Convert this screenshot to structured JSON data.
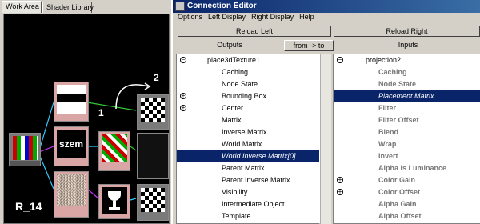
{
  "hypershade": {
    "tabs": [
      "Work Area",
      "Shader Library"
    ],
    "node_labels": {
      "r14": "R_14",
      "szem": "szem",
      "step1": "1",
      "step2": "2"
    }
  },
  "editor": {
    "title": "Connection Editor",
    "menu": [
      "Options",
      "Left Display",
      "Right Display",
      "Help"
    ],
    "reload_left": "Reload Left",
    "reload_right": "Reload Right",
    "outputs_label": "Outputs",
    "from_to": "from -> to",
    "inputs_label": "Inputs",
    "left_items": [
      {
        "label": "place3dTexture1",
        "kind": "root",
        "expander": "−"
      },
      {
        "label": "Caching",
        "kind": "attr"
      },
      {
        "label": "Node State",
        "kind": "attr"
      },
      {
        "label": "Bounding Box",
        "kind": "attr",
        "expander": "+"
      },
      {
        "label": "Center",
        "kind": "attr",
        "expander": "+"
      },
      {
        "label": "Matrix",
        "kind": "attr"
      },
      {
        "label": "Inverse Matrix",
        "kind": "attr"
      },
      {
        "label": "World Matrix",
        "kind": "attr"
      },
      {
        "label": "World Inverse Matrix[0]",
        "kind": "selected"
      },
      {
        "label": "Parent Matrix",
        "kind": "attr"
      },
      {
        "label": "Parent Inverse Matrix",
        "kind": "attr"
      },
      {
        "label": "Visibility",
        "kind": "attr"
      },
      {
        "label": "Intermediate Object",
        "kind": "attr"
      },
      {
        "label": "Template",
        "kind": "attr"
      }
    ],
    "right_items": [
      {
        "label": "projection2",
        "kind": "root",
        "expander": "−"
      },
      {
        "label": "Caching",
        "kind": "dim"
      },
      {
        "label": "Node State",
        "kind": "dim"
      },
      {
        "label": "Placement Matrix",
        "kind": "selected"
      },
      {
        "label": "Filter",
        "kind": "dim"
      },
      {
        "label": "Filter Offset",
        "kind": "dim"
      },
      {
        "label": "Blend",
        "kind": "dim"
      },
      {
        "label": "Wrap",
        "kind": "dim"
      },
      {
        "label": "Invert",
        "kind": "dim"
      },
      {
        "label": "Alpha Is Luminance",
        "kind": "dim"
      },
      {
        "label": "Color Gain",
        "kind": "dim",
        "expander": "+"
      },
      {
        "label": "Color Offset",
        "kind": "dim",
        "expander": "+"
      },
      {
        "label": "Alpha Gain",
        "kind": "dim"
      },
      {
        "label": "Alpha Offset",
        "kind": "dim"
      }
    ]
  }
}
